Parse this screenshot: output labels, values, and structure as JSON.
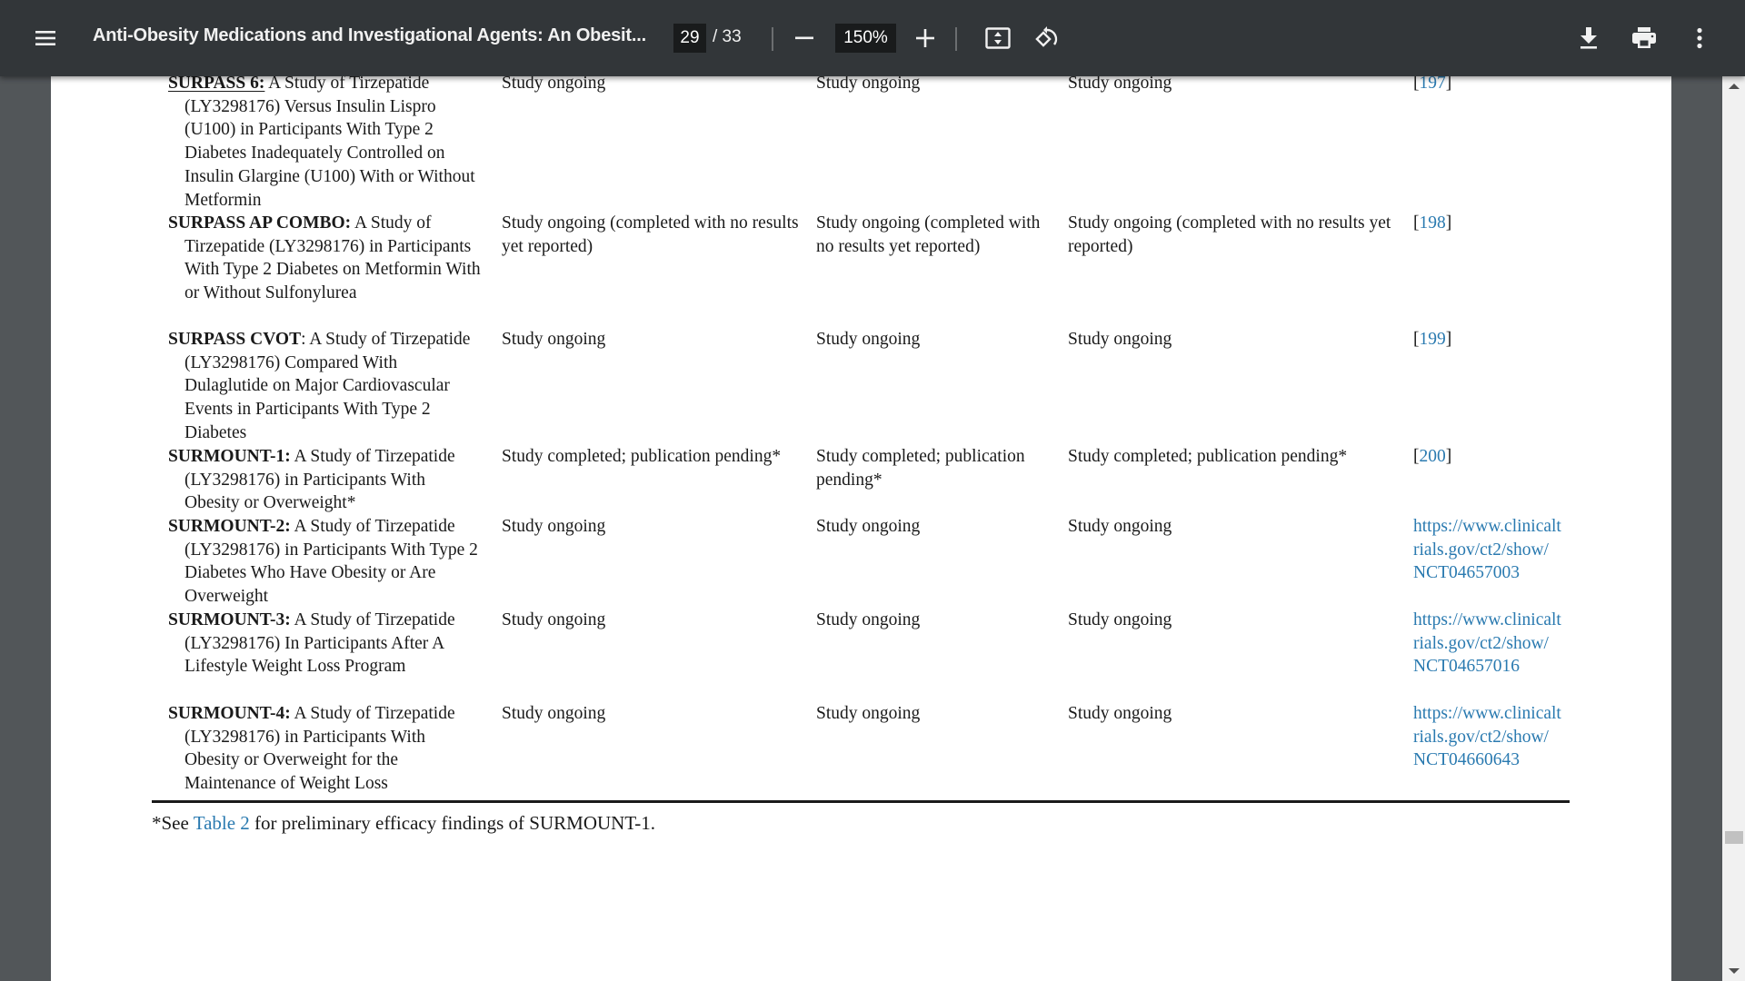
{
  "toolbar": {
    "menu_icon": "hamburger-menu-icon",
    "title": "Anti-Obesity Medications and Investigational Agents: An Obesit...",
    "page_current": "29",
    "page_total": "/ 33",
    "zoom_level": "150%",
    "icons": {
      "zoom_out": "minus-icon",
      "zoom_in": "plus-icon",
      "fit": "fit-to-page-icon",
      "rotate": "rotate-counterclockwise-icon",
      "download": "download-icon",
      "print": "print-icon",
      "more": "more-vertical-icon"
    }
  },
  "table": {
    "rows": [
      {
        "trial_name": "SURPASS 6:",
        "trial_desc": " A Study of Tirzepatide (LY3298176) Versus Insulin Lispro (U100) in Participants With Type 2 Diabetes Inadequately Controlled on Insulin Glargine (U100) With or Without Metformin",
        "col2": "Study ongoing",
        "col3": "Study ongoing",
        "col4": "Study ongoing",
        "ref": "197"
      },
      {
        "trial_name": "SURPASS AP COMBO:",
        "trial_desc": " A Study of Tirzepatide (LY3298176) in Participants With Type 2 Diabetes on Metformin With or Without Sulfonylurea",
        "col2": "Study ongoing (completed with no results yet reported)",
        "col3": "Study ongoing (completed with no results yet reported)",
        "col4": "Study ongoing (completed with no results yet reported)",
        "ref": "198"
      },
      {
        "trial_name": "SURPASS CVOT",
        "trial_desc": ": A Study of Tirzepatide (LY3298176) Compared With Dulaglutide on Major Cardiovascular Events in Participants With Type 2 Diabetes",
        "col2": "Study ongoing",
        "col3": "Study ongoing",
        "col4": "Study ongoing",
        "ref": "199"
      },
      {
        "trial_name": "SURMOUNT-1:",
        "trial_desc": " A Study of Tirzepatide (LY3298176) in Participants With Obesity or Overweight*",
        "col2": "Study completed; publication pending*",
        "col3": "Study completed; publication pending*",
        "col4": "Study completed; publication pending*",
        "ref": "200"
      },
      {
        "trial_name": "SURMOUNT-2:",
        "trial_desc": " A Study of Tirzepatide (LY3298176) in Participants With Type 2 Diabetes Who Have Obesity or Are Overweight",
        "col2": "Study ongoing",
        "col3": "Study ongoing",
        "col4": "Study ongoing",
        "url": "https://www.clinicaltrials.gov/ct2/show/NCT04657003"
      },
      {
        "trial_name": "SURMOUNT-3:",
        "trial_desc": " A Study of Tirzepatide (LY3298176) In Participants After A Lifestyle Weight Loss Program",
        "col2": "Study ongoing",
        "col3": "Study ongoing",
        "col4": "Study ongoing",
        "url": "https://www.clinicaltrials.gov/ct2/show/NCT04657016"
      },
      {
        "trial_name": "SURMOUNT-4:",
        "trial_desc": " A Study of Tirzepatide (LY3298176) in Participants With Obesity or Overweight for the Maintenance of Weight Loss",
        "col2": "Study ongoing",
        "col3": "Study ongoing",
        "col4": "Study ongoing",
        "url": "https://www.clinicaltrials.gov/ct2/show/NCT04660643"
      }
    ],
    "ref_open": "[",
    "ref_close": "]"
  },
  "footnote": {
    "prefix": "*See ",
    "link": "Table 2",
    "suffix": " for preliminary efficacy findings of SURMOUNT-1."
  },
  "colors": {
    "toolbar_bg": "#323639",
    "viewer_bg": "#525659",
    "link": "#2a7ab0"
  }
}
